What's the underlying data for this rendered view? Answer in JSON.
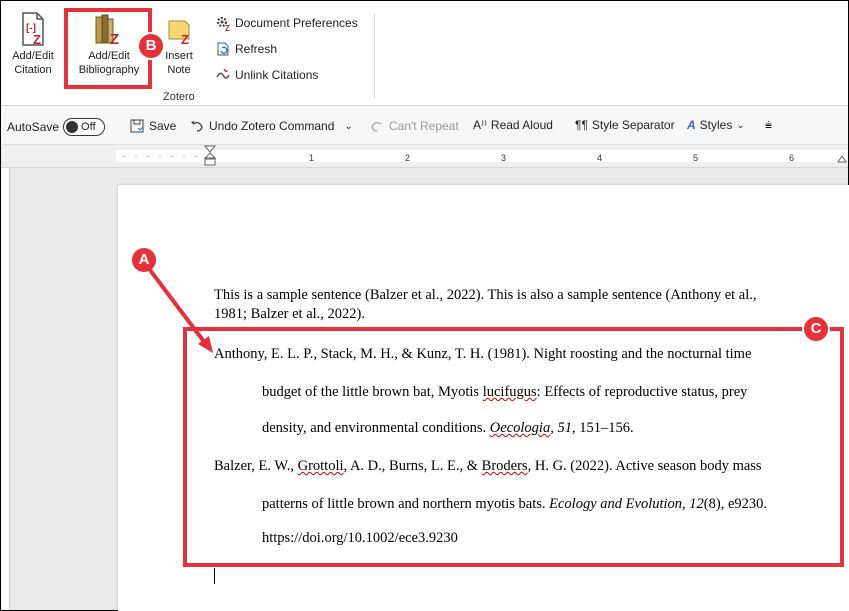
{
  "ribbon": {
    "buttons": [
      {
        "label1": "Add/Edit",
        "label2": "Citation"
      },
      {
        "label1": "Add/Edit",
        "label2": "Bibliography"
      },
      {
        "label1": "Insert",
        "label2": "Note"
      }
    ],
    "small_commands": [
      "Document Preferences",
      "Refresh",
      "Unlink Citations"
    ],
    "group_label": "Zotero"
  },
  "qat": {
    "autosave_label": "AutoSave",
    "autosave_state": "Off",
    "save": "Save",
    "undo": "Undo Zotero Command",
    "cant_repeat": "Can't Repeat",
    "read_aloud": "Read Aloud",
    "style_separator": "Style Separator",
    "styles": "Styles"
  },
  "ruler": {
    "numbers": [
      "1",
      "2",
      "3",
      "4",
      "5",
      "6"
    ]
  },
  "document": {
    "paragraph1_line1": "This is a sample sentence (Balzer et al., 2022). This is also a sample sentence (Anthony et al.,",
    "paragraph1_line2": "1981; Balzer et al., 2022).",
    "ref1": {
      "line1": "Anthony, E. L. P., Stack, M. H., & Kunz, T. H. (1981). Night roosting and the nocturnal time",
      "line2a": "budget of the little brown bat, Myotis ",
      "line2b": "lucifugus",
      "line2c": ": Effects of reproductive status, prey",
      "line3a": "density, and environmental conditions. ",
      "line3b": "Oecologia",
      "line3c": ", 51",
      "line3d": ", 151–156."
    },
    "ref2": {
      "line1a": "Balzer, E. W., ",
      "line1b": "Grottoli",
      "line1c": ", A. D., Burns, L. E., & ",
      "line1d": "Broders",
      "line1e": ", H. G. (2022). Active season body mass",
      "line2a": "patterns of little brown and northern myotis bats. ",
      "line2b": "Ecology and Evolution, 12",
      "line2c": "(8), e9230.",
      "line3": "https://doi.org/10.1002/ece3.9230"
    }
  },
  "annotations": {
    "a": "A",
    "b": "B",
    "c": "C",
    "color": "#e8303a"
  }
}
